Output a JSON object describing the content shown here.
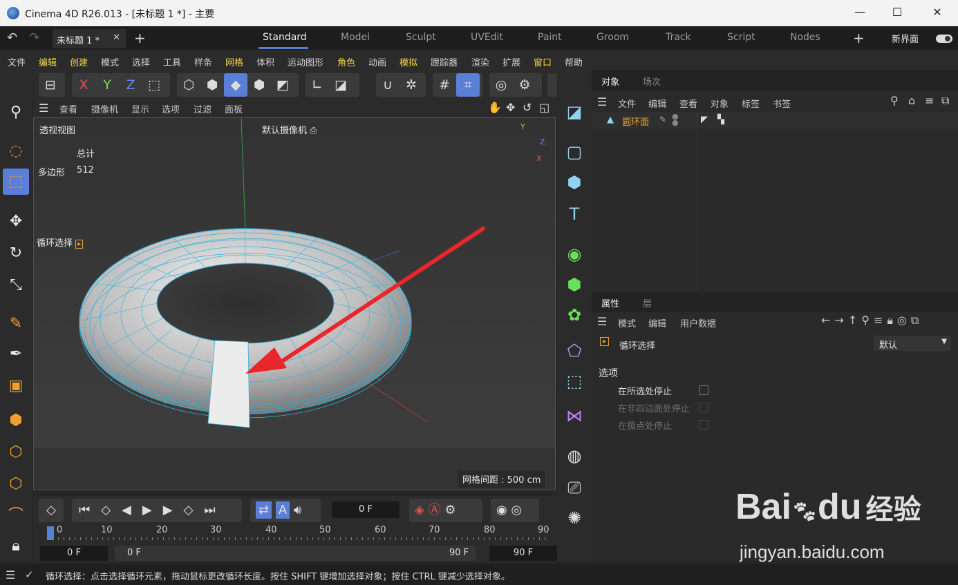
{
  "window": {
    "title": "Cinema 4D R26.013 - [未标题 1 *] - 主要"
  },
  "doc_tab": {
    "label": "未标题 1 *"
  },
  "layouts": [
    "Standard",
    "Model",
    "Sculpt",
    "UVEdit",
    "Paint",
    "Groom",
    "Track",
    "Script",
    "Nodes"
  ],
  "new_layout": "新界面",
  "menu": [
    "文件",
    "编辑",
    "创建",
    "模式",
    "选择",
    "工具",
    "样条",
    "网格",
    "体积",
    "运动图形",
    "角色",
    "动画",
    "模拟",
    "跟踪器",
    "渲染",
    "扩展",
    "窗口",
    "帮助"
  ],
  "axis_buttons": [
    "X",
    "Y",
    "Z"
  ],
  "viewport": {
    "menu": [
      "查看",
      "摄像机",
      "显示",
      "选项",
      "过滤",
      "面板"
    ],
    "title": "透视视图",
    "camera": "默认摄像机",
    "stats_header": "总计",
    "stats_label": "多边形",
    "stats_value": "512",
    "tool_label": "循环选择",
    "grid_spacing": "网格间距 : 500 cm",
    "axis_labels": {
      "y": "Y",
      "z": "Z",
      "x": "X"
    }
  },
  "object_panel": {
    "tabs": [
      "对象",
      "场次"
    ],
    "menu": [
      "文件",
      "编辑",
      "查看",
      "对象",
      "标签",
      "书签"
    ],
    "object_name": "圆环面"
  },
  "attr_panel": {
    "tabs": [
      "属性",
      "层"
    ],
    "menu": [
      "模式",
      "编辑",
      "用户数据"
    ],
    "tool_title": "循环选择",
    "preset": "默认",
    "section": "选项",
    "options": [
      {
        "label": "在所选处停止",
        "enabled": true,
        "checked": false
      },
      {
        "label": "在非四边面处停止",
        "enabled": false,
        "checked": false
      },
      {
        "label": "在极点处停止",
        "enabled": false,
        "checked": false
      }
    ]
  },
  "timeline": {
    "current_frame": "0 F",
    "ticks": [
      "0",
      "10",
      "20",
      "30",
      "40",
      "50",
      "60",
      "70",
      "80",
      "90"
    ],
    "start": "0 F",
    "range_start": "0 F",
    "range_end": "90 F",
    "end": "90 F"
  },
  "status": {
    "text": "循环选择：点击选择循环元素，拖动鼠标更改循环长度。按住 SHIFT 键增加选择对象；按住 CTRL 键减少选择对象。"
  },
  "watermark": {
    "brand": "Bai",
    "brand2": "du",
    "cn": "经验",
    "url": "jingyan.baidu.com"
  },
  "colors": {
    "accent_blue": "#5a7fd6",
    "highlight_yellow": "#f2d54a",
    "arrow_red": "#e8262b",
    "mesh_wire": "#3ab0d8"
  }
}
